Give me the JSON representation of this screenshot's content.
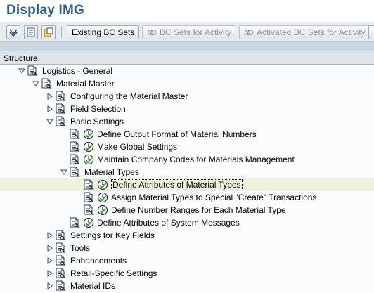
{
  "window": {
    "title": "Display IMG"
  },
  "toolbar": {
    "existing_bc_sets": "Existing BC Sets",
    "bc_sets_for_activity": "BC Sets for Activity",
    "activated_bc_sets_for_activity": "Activated BC Sets for Activity"
  },
  "tree": {
    "header": "Structure",
    "nodes": [
      {
        "label": "Logistics - General",
        "level": 0,
        "expander": "expanded",
        "exec": false,
        "selected": false
      },
      {
        "label": "Material Master",
        "level": 1,
        "expander": "expanded",
        "exec": false,
        "selected": false
      },
      {
        "label": "Configuring the Material Master",
        "level": 2,
        "expander": "collapsed",
        "exec": false,
        "selected": false
      },
      {
        "label": "Field Selection",
        "level": 2,
        "expander": "collapsed",
        "exec": false,
        "selected": false
      },
      {
        "label": "Basic Settings",
        "level": 2,
        "expander": "expanded",
        "exec": false,
        "selected": false
      },
      {
        "label": "Define Output Format of Material Numbers",
        "level": 3,
        "expander": "none",
        "exec": true,
        "selected": false
      },
      {
        "label": "Make Global Settings",
        "level": 3,
        "expander": "none",
        "exec": true,
        "selected": false
      },
      {
        "label": "Maintain Company Codes for Materials Management",
        "level": 3,
        "expander": "none",
        "exec": true,
        "selected": false
      },
      {
        "label": "Material Types",
        "level": 3,
        "expander": "expanded",
        "exec": false,
        "selected": false
      },
      {
        "label": "Define Attributes of Material Types",
        "level": 4,
        "expander": "none",
        "exec": true,
        "selected": true
      },
      {
        "label": "Assign Material Types to Special \"Create\" Transactions",
        "level": 4,
        "expander": "none",
        "exec": true,
        "selected": false
      },
      {
        "label": "Define Number Ranges for Each Material Type",
        "level": 4,
        "expander": "none",
        "exec": true,
        "selected": false
      },
      {
        "label": "Define Attributes of System Messages",
        "level": 3,
        "expander": "none",
        "exec": true,
        "selected": false
      },
      {
        "label": "Settings for Key Fields",
        "level": 2,
        "expander": "collapsed",
        "exec": false,
        "selected": false
      },
      {
        "label": "Tools",
        "level": 2,
        "expander": "collapsed",
        "exec": false,
        "selected": false
      },
      {
        "label": "Enhancements",
        "level": 2,
        "expander": "collapsed",
        "exec": false,
        "selected": false
      },
      {
        "label": "Retail-Specific Settings",
        "level": 2,
        "expander": "collapsed",
        "exec": false,
        "selected": false
      },
      {
        "label": "Material IDs",
        "level": 2,
        "expander": "collapsed",
        "exec": false,
        "selected": false
      }
    ]
  },
  "icons": {
    "expand": "triangle-right-icon",
    "collapse": "triangle-down-icon",
    "document": "img-document-icon",
    "execute": "clock-execute-icon"
  },
  "colors": {
    "title": "#2f5d8c",
    "toolbar_bg": "#e7ecf1",
    "band": "#cad6e2",
    "selected_row": "#eef2dc",
    "execute_green": "#2e9a2e"
  }
}
